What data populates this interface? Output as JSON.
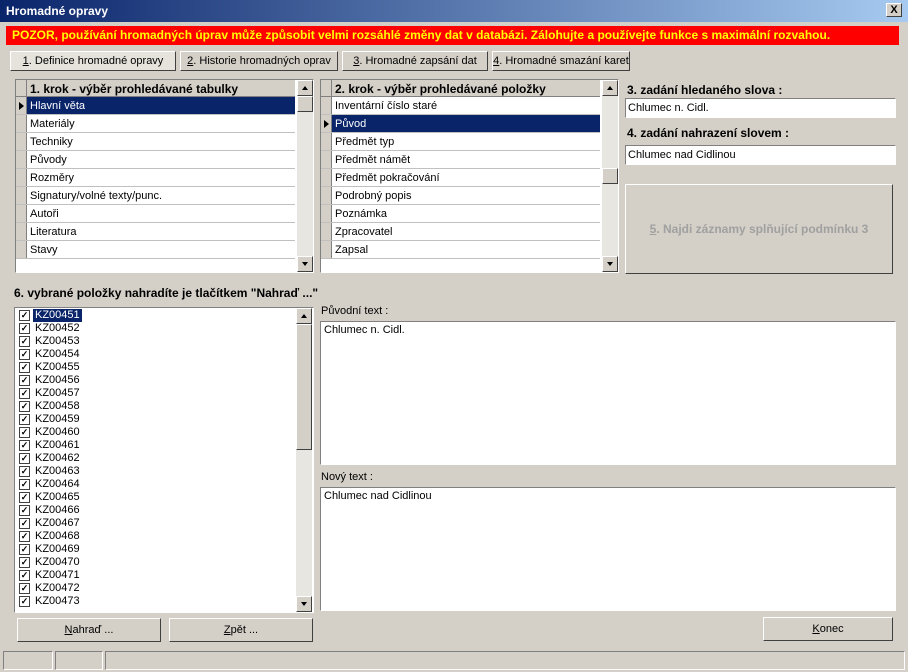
{
  "window": {
    "title": "Hromadné opravy",
    "close_label": "X"
  },
  "warning": "POZOR, používání hromadných úprav může způsobit velmi rozsáhlé změny dat v databázi. Zálohujte a používejte funkce s maximální rozvahou.",
  "tabs": [
    {
      "key": "1",
      "label": ". Definice hromadné opravy",
      "active": true
    },
    {
      "key": "2",
      "label": ". Historie hromadných oprav",
      "active": false
    },
    {
      "key": "3",
      "label": ". Hromadné zapsání dat",
      "active": false
    },
    {
      "key": "4",
      "label": ". Hromadné smazání karet",
      "active": false
    }
  ],
  "table_grid": {
    "header": "1. krok - výběr prohledávané tabulky",
    "rows": [
      "Hlavní věta",
      "Materiály",
      "Techniky",
      "Původy",
      "Rozměry",
      "Signatury/volné texty/punc.",
      "Autoři",
      "Literatura",
      "Stavy"
    ],
    "selected_index": 0
  },
  "field_grid": {
    "header": "2. krok - výběr prohledávané položky",
    "rows": [
      "Inventární číslo staré",
      "Původ",
      "Předmět typ",
      "Předmět námět",
      "Předmět pokračování",
      "Podrobný popis",
      "Poznámka",
      "Zpracovatel",
      "Zapsal"
    ],
    "selected_index": 1
  },
  "search": {
    "label": "3. zadání hledaného slova :",
    "value": "Chlumec n. Cidl.",
    "replace_label": "4. zadání nahrazení slovem :",
    "replace_value": "Chlumec nad Cidlinou",
    "find_button_key": "5",
    "find_button_label": ". Najdi záznamy splňující podmínku 3"
  },
  "results": {
    "label": "6. vybrané položky nahradíte je tlačítkem \"Nahraď ...\"",
    "items": [
      "KZ00451",
      "KZ00452",
      "KZ00453",
      "KZ00454",
      "KZ00455",
      "KZ00456",
      "KZ00457",
      "KZ00458",
      "KZ00459",
      "KZ00460",
      "KZ00461",
      "KZ00462",
      "KZ00463",
      "KZ00464",
      "KZ00465",
      "KZ00466",
      "KZ00467",
      "KZ00468",
      "KZ00469",
      "KZ00470",
      "KZ00471",
      "KZ00472",
      "KZ00473"
    ],
    "selected_index": 0,
    "checked": true
  },
  "original_text": {
    "label": "Původní text :",
    "value": "Chlumec n. Cidl."
  },
  "new_text": {
    "label": "Nový text :",
    "value": "Chlumec nad Cidlinou"
  },
  "buttons": {
    "replace_u": "N",
    "replace_rest": "ahraď ...",
    "back_u": "Z",
    "back_rest": "pět ...",
    "end_u": "K",
    "end_rest": "onec"
  },
  "colors": {
    "selection": "#0a246a",
    "warning_bg": "#ff0000",
    "warning_text": "#ffff00"
  }
}
